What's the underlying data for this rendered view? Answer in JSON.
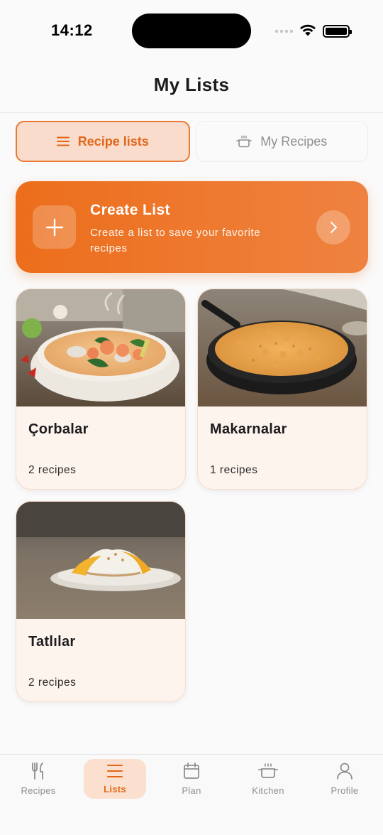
{
  "status_bar": {
    "time": "14:12"
  },
  "header": {
    "title": "My Lists"
  },
  "tabs": [
    {
      "label": "Recipe lists",
      "icon": "list-icon",
      "active": true
    },
    {
      "label": "My Recipes",
      "icon": "pot-icon",
      "active": false
    }
  ],
  "create_card": {
    "title": "Create List",
    "subtitle": "Create a list to save your favorite recipes"
  },
  "lists": [
    {
      "name": "Çorbalar",
      "count": "2 recipes",
      "image": "shrimp soup bowl"
    },
    {
      "name": "Makarnalar",
      "count": "1 recipes",
      "image": "baked mac and cheese skillet"
    },
    {
      "name": "Tatlılar",
      "count": "2 recipes",
      "image": "mango sticky rice plate"
    }
  ],
  "bottom_nav": [
    {
      "label": "Recipes",
      "icon": "fork-knife-icon",
      "active": false
    },
    {
      "label": "Lists",
      "icon": "list-icon",
      "active": true
    },
    {
      "label": "Plan",
      "icon": "calendar-icon",
      "active": false
    },
    {
      "label": "Kitchen",
      "icon": "pot-icon",
      "active": false
    },
    {
      "label": "Profile",
      "icon": "person-icon",
      "active": false
    }
  ],
  "colors": {
    "accent": "#e2661a",
    "accent_light": "#f9dccb",
    "card_bg": "#fef4ee"
  }
}
